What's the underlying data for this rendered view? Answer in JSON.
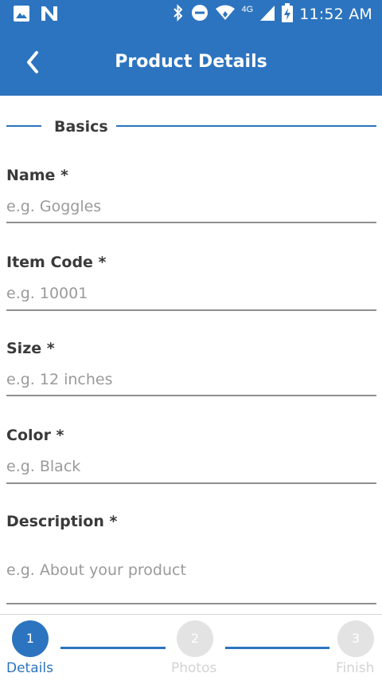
{
  "statusbar": {
    "time": "11:52 AM",
    "network": "4G",
    "icons": [
      "image-icon",
      "n-app-icon",
      "bluetooth-icon",
      "do-not-disturb-icon",
      "wifi-icon",
      "signal-icon",
      "battery-charging-icon"
    ]
  },
  "appbar": {
    "title": "Product Details",
    "back_icon": "chevron-left-icon"
  },
  "section": {
    "label": "Basics"
  },
  "fields": [
    {
      "label": "Name *",
      "placeholder": "e.g. Goggles",
      "value": ""
    },
    {
      "label": "Item Code *",
      "placeholder": "e.g. 10001",
      "value": ""
    },
    {
      "label": "Size *",
      "placeholder": "e.g. 12 inches",
      "value": ""
    },
    {
      "label": "Color *",
      "placeholder": "e.g. Black",
      "value": ""
    },
    {
      "label": "Description *",
      "placeholder": "e.g. About your product",
      "value": ""
    }
  ],
  "stepper": {
    "steps": [
      {
        "number": "1",
        "label": "Details",
        "active": true
      },
      {
        "number": "2",
        "label": "Photos",
        "active": false
      },
      {
        "number": "3",
        "label": "Finish",
        "active": false
      }
    ]
  },
  "colors": {
    "primary": "#2c74bf",
    "inactive_step": "#e3e3e3",
    "inactive_text": "#d3d3d3",
    "placeholder": "#9a9a9a",
    "label": "#3a3a3a",
    "underline": "#8f8f8f"
  }
}
